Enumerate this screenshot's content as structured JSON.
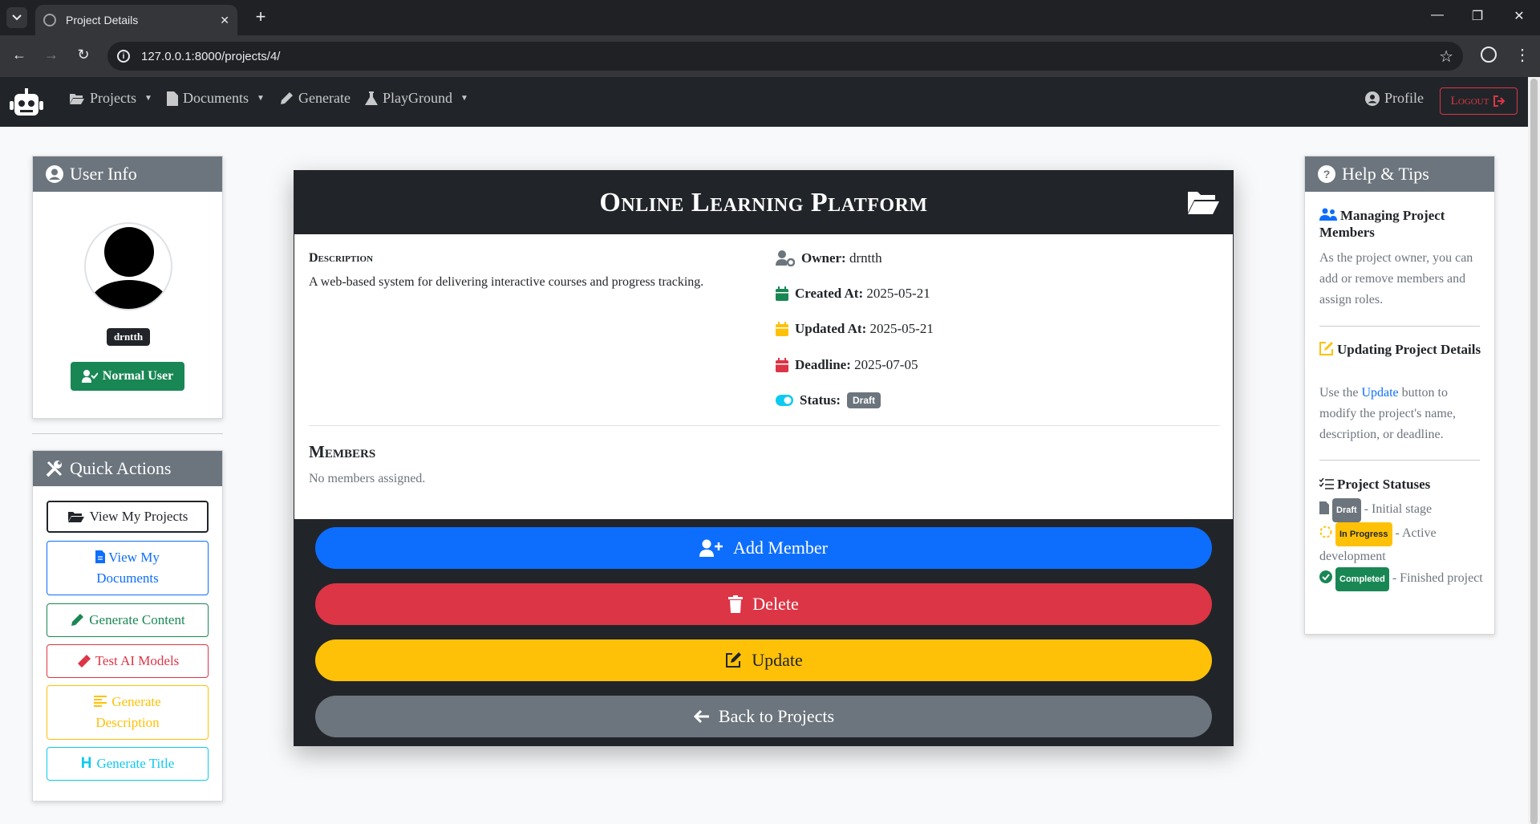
{
  "browser": {
    "tab_title": "Project Details",
    "url": "127.0.0.1:8000/projects/4/"
  },
  "navbar": {
    "projects": "Projects",
    "documents": "Documents",
    "generate": "Generate",
    "playground": "PlayGround",
    "profile": "Profile",
    "logout": "Logout"
  },
  "user_info": {
    "title": "User Info",
    "username": "drntth",
    "role": "Normal User"
  },
  "quick_actions": {
    "title": "Quick Actions",
    "view_projects": "View My Projects",
    "view_documents": "View My Documents",
    "generate_content": "Generate Content",
    "test_ai": "Test AI Models",
    "generate_description": "Generate Description",
    "generate_title": "Generate Title"
  },
  "project": {
    "title": "Online Learning Platform",
    "description_heading": "Description",
    "description": "A web-based system for delivering interactive courses and progress tracking.",
    "owner_label": "Owner:",
    "owner": "drntth",
    "created_label": "Created At:",
    "created": "2025-05-21",
    "updated_label": "Updated At:",
    "updated": "2025-05-21",
    "deadline_label": "Deadline:",
    "deadline": "2025-07-05",
    "status_label": "Status:",
    "status": "Draft",
    "members_heading": "Members",
    "members_text": "No members assigned."
  },
  "actions": {
    "add_member": "Add Member",
    "delete": "Delete",
    "update": "Update",
    "back": "Back to Projects"
  },
  "help": {
    "title": "Help & Tips",
    "s1_title": "Managing Project Members",
    "s1_text": "As the project owner, you can add or remove members and assign roles.",
    "s2_title": "Updating Project Details",
    "s2_pre": "Use the",
    "s2_link": "Update",
    "s2_post": "button to modify the project's name, description, or deadline.",
    "s3_title": "Project Statuses",
    "st_draft": "Draft",
    "st_draft_text": "- Initial stage",
    "st_progress": "In Progress",
    "st_progress_text": "- Active development",
    "st_completed": "Completed",
    "st_completed_text": "- Finished project"
  },
  "colors": {
    "dark": "#212529",
    "secondary": "#6c757d",
    "primary": "#0d6efd",
    "danger": "#dc3545",
    "warning": "#ffc107",
    "success": "#198754",
    "info": "#0dcaf0"
  }
}
